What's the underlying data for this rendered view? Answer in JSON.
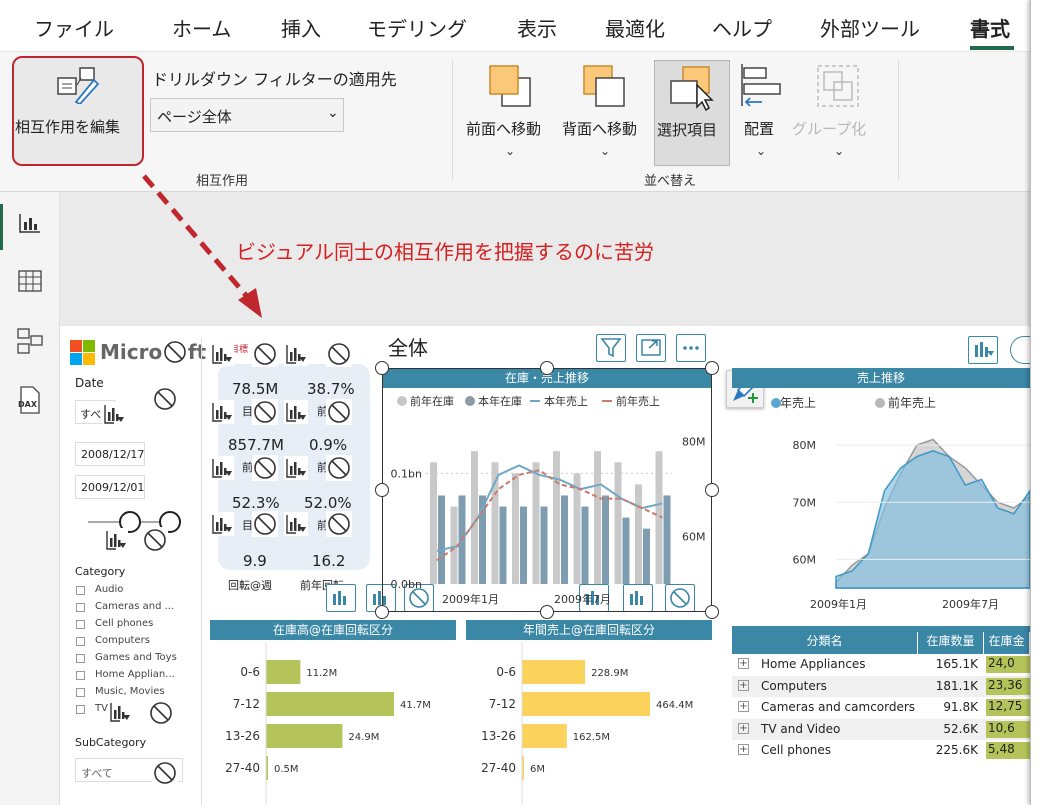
{
  "menubar": {
    "items": [
      "ファイル",
      "ホーム",
      "挿入",
      "モデリング",
      "表示",
      "最適化",
      "ヘルプ",
      "外部ツール",
      "書式"
    ],
    "active": "書式"
  },
  "ribbon": {
    "edit_interactions_label": "相互作用を編集",
    "drillthrough_label": "ドリルダウン フィルターの適用先",
    "drillthrough_value": "ページ全体",
    "group_interaction": "相互作用",
    "bring_forward": "前面へ移動",
    "send_backward": "背面へ移動",
    "selection_pane": "選択項目",
    "align": "配置",
    "group": "グループ化",
    "group_arrange": "並べ替え"
  },
  "annotation": "ビジュアル同士の相互作用を把握するのに苦労",
  "report": {
    "page_title": "全体",
    "logo": "Microsoft",
    "date_label": "Date",
    "date_dropdown": "すべ",
    "date_from": "2008/12/17",
    "date_to": "2009/12/01",
    "category_label": "Category",
    "categories": [
      "Audio",
      "Cameras and ...",
      "Cell phones",
      "Computers",
      "Games and Toys",
      "Home Applian...",
      "Music, Movies",
      "TV"
    ],
    "subcategory_label": "SubCategory",
    "subcategory_dropdown": "すべて",
    "kpis": [
      {
        "value": "78.5M",
        "label": "目"
      },
      {
        "value": "38.7%",
        "label": "前"
      },
      {
        "value": "857.7M",
        "label": "前"
      },
      {
        "value": "0.9%",
        "label": "前"
      },
      {
        "value": "52.3%",
        "label": "目"
      },
      {
        "value": "52.0%",
        "label": "前"
      },
      {
        "value": "9.9",
        "label": "回転@週"
      },
      {
        "value": "16.2",
        "label": "前年回転"
      }
    ],
    "kpi_badge": "目標"
  },
  "chart_data": [
    {
      "type": "bar",
      "title": "在庫・売上推移",
      "legend": [
        "前年在庫",
        "本年在庫",
        "本年売上",
        "前年売上"
      ],
      "x_ticks": [
        "2009年1月",
        "2009年7月"
      ],
      "y_left_ticks": [
        "0.0bn",
        "0.1bn"
      ],
      "y_right_ticks": [
        "60M",
        "80M"
      ],
      "series": [
        {
          "name": "前年在庫",
          "values": [
            0.11,
            0.07,
            0.12,
            0.11,
            0.1,
            0.11,
            0.12,
            0.1,
            0.12,
            0.11,
            0.09,
            0.12
          ]
        },
        {
          "name": "本年在庫",
          "values": [
            0.08,
            0.08,
            0.08,
            0.07,
            0.07,
            0.07,
            0.08,
            0.07,
            0.08,
            0.06,
            0.05,
            0.08
          ]
        },
        {
          "name": "本年売上",
          "values": [
            57,
            58,
            64,
            73,
            75,
            73,
            72,
            70,
            71,
            68,
            66,
            67
          ]
        },
        {
          "name": "前年売上",
          "values": [
            55,
            58,
            64,
            70,
            73,
            74,
            71,
            70,
            68,
            68,
            66,
            64
          ]
        }
      ]
    },
    {
      "type": "area",
      "title": "売上推移",
      "legend": [
        "年売上",
        "前年売上"
      ],
      "x_ticks": [
        "2009年1月",
        "2009年7月"
      ],
      "y_ticks": [
        "60M",
        "70M",
        "80M"
      ],
      "series": [
        {
          "name": "年売上",
          "values": [
            57,
            58,
            61,
            72,
            76,
            78,
            79,
            78,
            73,
            74,
            69,
            68,
            72
          ]
        },
        {
          "name": "前年売上",
          "values": [
            56,
            59,
            61,
            69,
            75,
            80,
            81,
            78,
            76,
            73,
            70,
            69,
            71
          ]
        }
      ]
    },
    {
      "type": "bar",
      "title": "在庫高@在庫回転区分",
      "categories": [
        "0-6",
        "7-12",
        "13-26",
        "27-40"
      ],
      "values": [
        11.2,
        41.7,
        24.9,
        0.5
      ],
      "data_labels": [
        "11.2M",
        "41.7M",
        "24.9M",
        "0.5M"
      ],
      "color": "#b5c45a"
    },
    {
      "type": "bar",
      "title": "年間売上@在庫回転区分",
      "categories": [
        "0-6",
        "7-12",
        "13-26",
        "27-40"
      ],
      "values": [
        228.9,
        464.4,
        162.5,
        5
      ],
      "data_labels": [
        "228.9M",
        "464.4M",
        "162.5M",
        "6M"
      ],
      "color": "#fbd35c"
    },
    {
      "type": "table",
      "columns": [
        "分類名",
        "在庫数量",
        "在庫金"
      ],
      "rows": [
        [
          "Home Appliances",
          "165.1K",
          "24,0"
        ],
        [
          "Computers",
          "181.1K",
          "23,36"
        ],
        [
          "Cameras and camcorders",
          "91.8K",
          "12,75"
        ],
        [
          "TV and Video",
          "52.6K",
          "10,6"
        ],
        [
          "Cell phones",
          "225.6K",
          "5,48"
        ]
      ]
    }
  ]
}
